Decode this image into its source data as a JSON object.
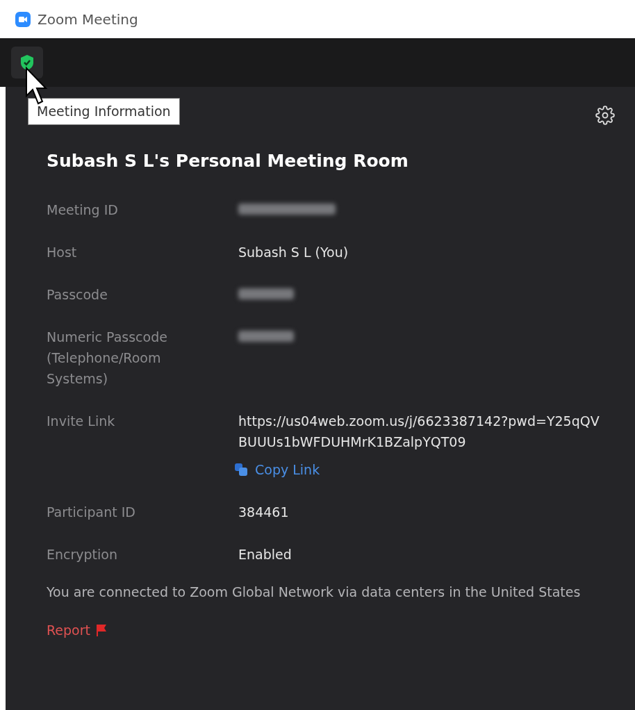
{
  "window": {
    "title": "Zoom Meeting"
  },
  "toolbar": {
    "tooltip": "Meeting Information"
  },
  "panel": {
    "title": "Subash S L's Personal Meeting Room",
    "rows": [
      {
        "label": "Meeting ID",
        "kind": "redacted"
      },
      {
        "label": "Host",
        "kind": "text",
        "value": "Subash S L (You)"
      },
      {
        "label": "Passcode",
        "kind": "redacted"
      },
      {
        "label": "Numeric Passcode (Telephone/Room Systems)",
        "kind": "redacted"
      },
      {
        "label": "Invite Link",
        "kind": "link",
        "value": "https://us04web.zoom.us/j/6623387142?pwd=Y25qQVBUUUs1bWFDUHMrK1BZalpYQT09",
        "action": "Copy Link"
      },
      {
        "label": "Participant ID",
        "kind": "text",
        "value": "384461"
      },
      {
        "label": "Encryption",
        "kind": "text",
        "value": "Enabled"
      }
    ],
    "network_note": "You are connected to Zoom Global Network via data centers in the United States",
    "report": "Report"
  }
}
